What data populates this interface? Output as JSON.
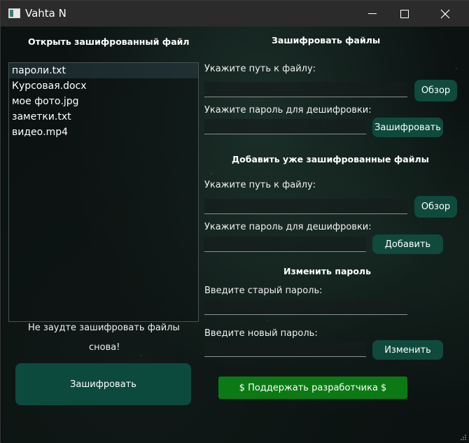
{
  "window": {
    "title": "Vahta N",
    "controls": {
      "minimize": "minimize",
      "maximize": "maximize",
      "close": "close"
    }
  },
  "left_panel": {
    "heading": "Открыть зашифрованный файл",
    "files": [
      "пароли.txt",
      "Курсовая.docx",
      "мое фото.jpg",
      "заметки.txt",
      "видео.mp4"
    ],
    "selected_index": 0,
    "reminder_line1": "Не заудте зашифровать файлы",
    "reminder_line2": "снова!",
    "encrypt_button": "Зашифровать"
  },
  "encrypt_section": {
    "heading": "Зашифровать файлы",
    "path_label": "Укажите путь к файлу:",
    "path_value": "",
    "browse_button": "Обзор",
    "password_label": "Укажите пароль для дешифровки:",
    "password_value": "",
    "submit_button": "Зашифровать"
  },
  "add_section": {
    "heading": "Добавить уже зашифрованные файлы",
    "path_label": "Укажите путь к файлу:",
    "path_value": "",
    "browse_button": "Обзор",
    "password_label": "Укажите пароль для дешифровки:",
    "password_value": "",
    "submit_button": "Добавить"
  },
  "change_password_section": {
    "heading": "Изменить пароль",
    "old_label": "Введите старый пароль:",
    "old_value": "",
    "new_label": "Введите новый пароль:",
    "new_value": "",
    "submit_button": "Изменить"
  },
  "donate_button": "$ Поддержать разработчика $",
  "colors": {
    "button": "#0f4a3d",
    "donate": "#0b7a14",
    "titlebar": "#2b2b2b"
  }
}
